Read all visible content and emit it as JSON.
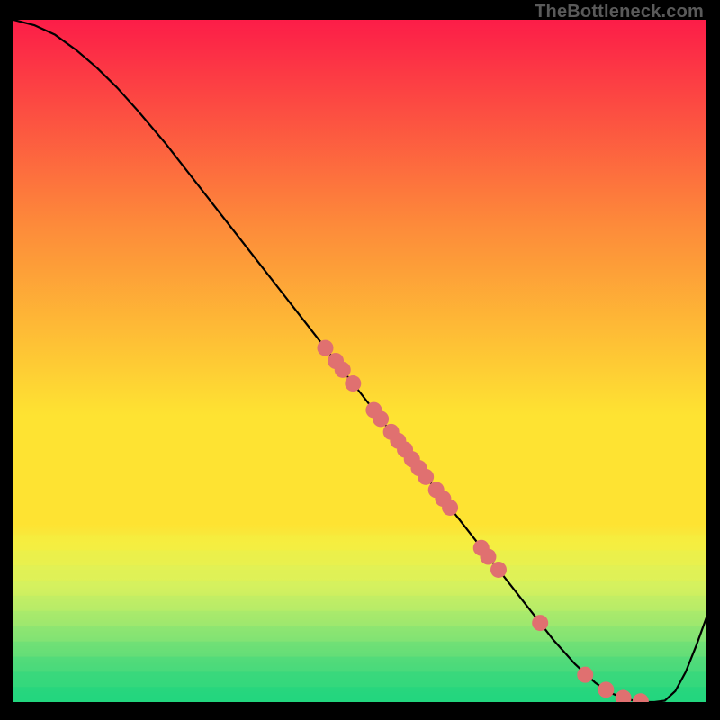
{
  "watermark": "TheBottleneck.com",
  "chart_data": {
    "type": "line",
    "title": "",
    "xlabel": "",
    "ylabel": "",
    "xlim": [
      0,
      100
    ],
    "ylim": [
      0,
      100
    ],
    "legend": false,
    "grid": false,
    "background_gradient": {
      "top": "#fc1d48",
      "upper_mid": "#fd8a3a",
      "mid": "#fee332",
      "lower_mid": "#dbf35c",
      "bottom": "#1bd97e"
    },
    "bottom_accent_band": {
      "start_y": 75,
      "end_y": 100
    },
    "series": [
      {
        "name": "curve",
        "color": "#000000",
        "width": 2.2,
        "x": [
          0,
          3,
          6,
          9,
          12,
          15,
          18,
          22,
          26,
          30,
          34,
          38,
          42,
          46,
          50,
          54,
          58,
          62,
          66,
          70,
          74,
          78,
          81,
          84,
          86,
          88,
          89.5,
          91,
          92.5,
          94,
          95.5,
          97,
          98.5,
          100
        ],
        "y": [
          100,
          99.2,
          97.8,
          95.6,
          93,
          90,
          86.6,
          81.8,
          76.6,
          71.4,
          66.2,
          61,
          55.8,
          50.6,
          45.4,
          40.2,
          35,
          29.8,
          24.6,
          19.4,
          14.2,
          9,
          5.6,
          2.8,
          1.4,
          0.6,
          0.2,
          0,
          0,
          0.2,
          1.6,
          4.4,
          8.2,
          12.4
        ]
      }
    ],
    "scatter": {
      "name": "markers",
      "color": "#e07070",
      "radius": 9,
      "points": [
        {
          "x": 45.0,
          "y": 51.9
        },
        {
          "x": 46.5,
          "y": 50.0
        },
        {
          "x": 47.5,
          "y": 48.7
        },
        {
          "x": 49.0,
          "y": 46.7
        },
        {
          "x": 52.0,
          "y": 42.8
        },
        {
          "x": 53.0,
          "y": 41.5
        },
        {
          "x": 54.5,
          "y": 39.6
        },
        {
          "x": 55.5,
          "y": 38.3
        },
        {
          "x": 56.5,
          "y": 37.0
        },
        {
          "x": 57.5,
          "y": 35.6
        },
        {
          "x": 58.5,
          "y": 34.3
        },
        {
          "x": 59.5,
          "y": 33.0
        },
        {
          "x": 61.0,
          "y": 31.1
        },
        {
          "x": 62.0,
          "y": 29.8
        },
        {
          "x": 63.0,
          "y": 28.5
        },
        {
          "x": 67.5,
          "y": 22.6
        },
        {
          "x": 68.5,
          "y": 21.3
        },
        {
          "x": 70.0,
          "y": 19.4
        },
        {
          "x": 76.0,
          "y": 11.6
        },
        {
          "x": 82.5,
          "y": 4.0
        },
        {
          "x": 85.5,
          "y": 1.8
        },
        {
          "x": 88.0,
          "y": 0.6
        },
        {
          "x": 90.5,
          "y": 0.1
        }
      ]
    }
  }
}
